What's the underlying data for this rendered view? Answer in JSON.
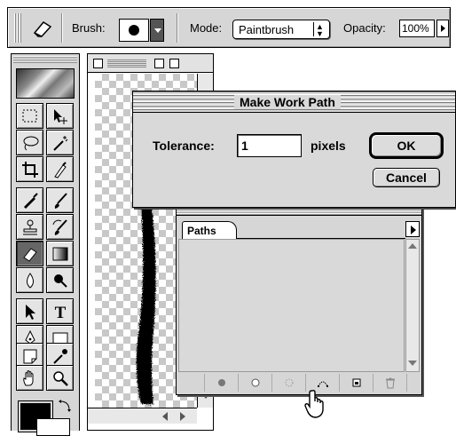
{
  "options_bar": {
    "brush_label": "Brush:",
    "mode_label": "Mode:",
    "mode_value": "Paintbrush",
    "opacity_label": "Opacity:",
    "opacity_value": "100%",
    "tool_icon": "eraser-icon",
    "brush_shape": "round-hard-brush"
  },
  "toolbox": {
    "tools": [
      "rectangular-marquee-icon",
      "move-icon",
      "lasso-icon",
      "magic-wand-icon",
      "crop-icon",
      "slice-icon",
      "airbrush-icon",
      "paintbrush-icon",
      "clone-stamp-icon",
      "history-brush-icon",
      "eraser-icon",
      "gradient-icon",
      "blur-icon",
      "burn-icon",
      "path-selection-icon",
      "type-icon",
      "pen-icon",
      "rectangle-shape-icon",
      "notes-icon",
      "eyedropper-icon",
      "hand-icon",
      "zoom-icon"
    ],
    "selected_tool": "eraser-icon",
    "foreground_color": "#000000",
    "background_color": "#ffffff"
  },
  "dialog": {
    "title": "Make Work Path",
    "tolerance_label": "Tolerance:",
    "tolerance_value": "1",
    "units_label": "pixels",
    "ok_label": "OK",
    "cancel_label": "Cancel"
  },
  "paths_palette": {
    "tab_label": "Paths",
    "bottom_buttons": [
      "fill-path-icon",
      "stroke-path-icon",
      "load-path-as-selection-icon",
      "make-work-path-icon",
      "new-path-icon",
      "trash-icon"
    ]
  },
  "colors": {
    "chrome": "#d6d6d6",
    "dialog_bg": "#d9d9d9",
    "transparency_checker": "#c8c8c8"
  }
}
